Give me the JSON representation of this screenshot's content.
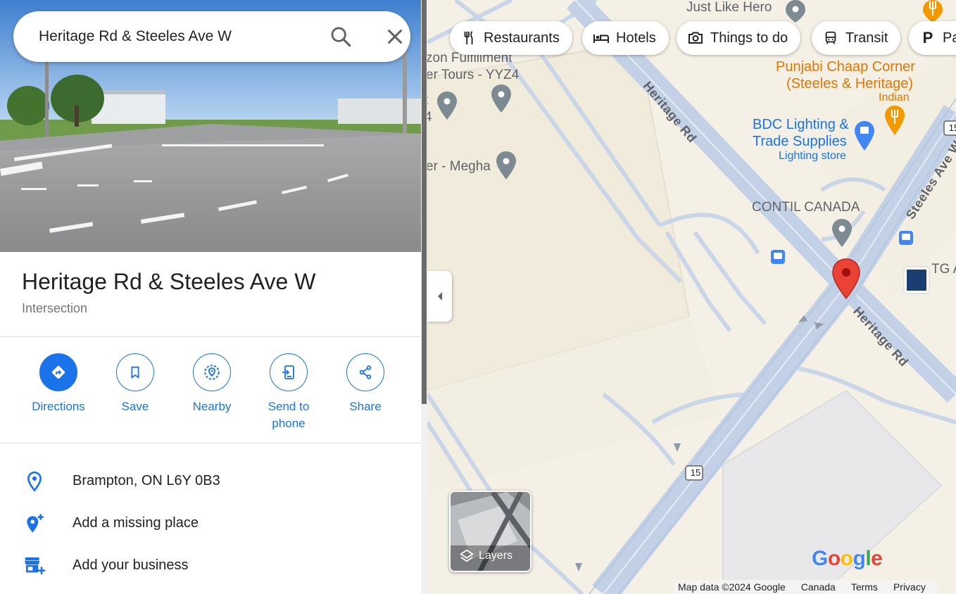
{
  "search": {
    "value": "Heritage Rd & Steeles Ave W"
  },
  "place": {
    "title": "Heritage Rd & Steeles Ave W",
    "type": "Intersection"
  },
  "actions": [
    {
      "label": "Directions",
      "icon": "directions-icon"
    },
    {
      "label": "Save",
      "icon": "bookmark-icon"
    },
    {
      "label": "Nearby",
      "icon": "nearby-icon"
    },
    {
      "label": "Send to phone",
      "label_line1": "Send to",
      "label_line2": "phone",
      "icon": "send-to-phone-icon"
    },
    {
      "label": "Share",
      "icon": "share-icon"
    }
  ],
  "info": {
    "address": "Brampton, ON L6Y 0B3",
    "add_missing_place": "Add a missing place",
    "add_business": "Add your business"
  },
  "map": {
    "chips": [
      {
        "label": "Restaurants",
        "icon": "restaurant-icon"
      },
      {
        "label": "Hotels",
        "icon": "hotel-icon"
      },
      {
        "label": "Things to do",
        "icon": "camera-icon"
      },
      {
        "label": "Transit",
        "icon": "transit-icon"
      },
      {
        "label": "Pa",
        "icon": "parking-icon"
      }
    ],
    "pois": {
      "just_like_hero": "Just Like Hero",
      "amazon_line1": "zon Fulfillment",
      "amazon_line2": "er Tours - YYZ4",
      "amazon_frag": "t",
      "amazon_frag2": "4",
      "megha": "er - Megha",
      "punjabi_line1": "Punjabi Chaap Corner",
      "punjabi_line2": "(Steeles & Heritage)",
      "punjabi_sub": "Indian",
      "bdc_line1": "BDC Lighting &",
      "bdc_line2": "Trade Supplies",
      "bdc_sub": "Lighting store",
      "contil": "CONTIL CANADA",
      "tg": "TG A",
      "route15": "15",
      "route15b": "15"
    },
    "roads": {
      "heritage_top": "Heritage Rd",
      "heritage_bottom": "Heritage Rd",
      "steeles": "Steeles Ave W"
    },
    "layers_label": "Layers",
    "logo": "Google",
    "footer": {
      "map_data": "Map data ©2024 Google",
      "region": "Canada",
      "terms": "Terms",
      "privacy": "Privacy"
    },
    "colors": {
      "accent": "#1a73e8",
      "pin_red": "#ea4335",
      "road": "#c4d2e6",
      "land": "#f5f0e5"
    }
  }
}
